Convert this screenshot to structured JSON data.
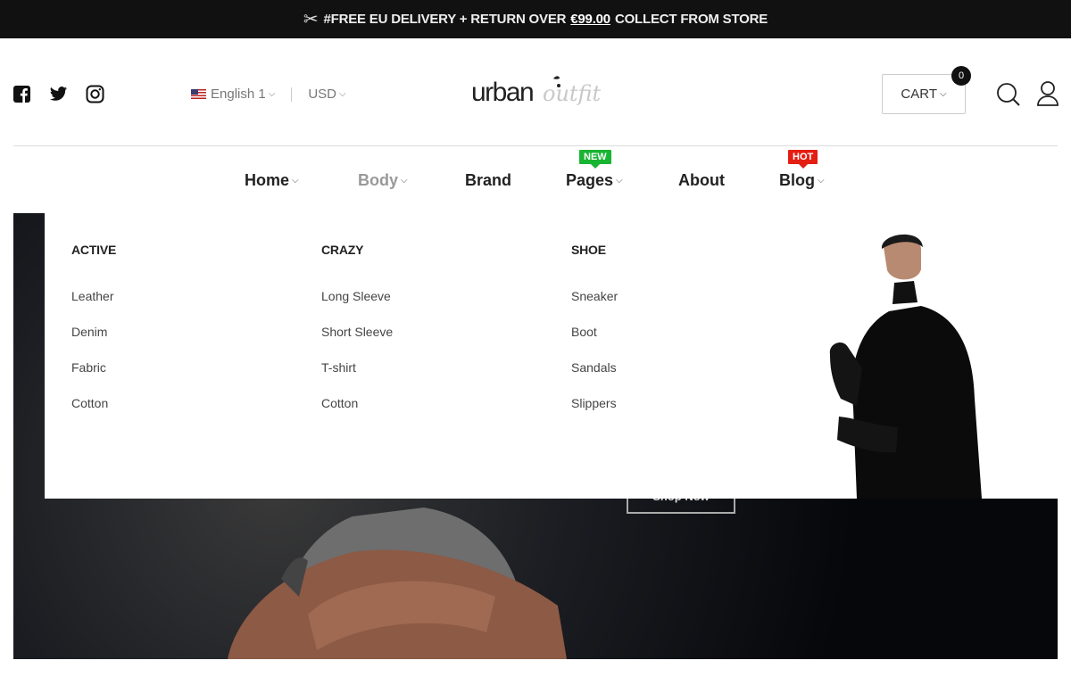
{
  "topbar": {
    "icon": "scissors-icon",
    "text_before": "#FREE EU DELIVERY + RETURN OVER",
    "price": "€99.00",
    "text_after": "COLLECT FROM STORE"
  },
  "social": [
    "facebook-icon",
    "twitter-icon",
    "instagram-icon"
  ],
  "language": {
    "selected": "English 1",
    "flag": "us-flag-icon"
  },
  "currency": {
    "selected": "USD"
  },
  "logo": {
    "text_main": "urban",
    "text_script": "outfit"
  },
  "cart": {
    "label": "CART",
    "count": "0"
  },
  "nav": {
    "items": [
      {
        "label": "Home",
        "has_dropdown": true
      },
      {
        "label": "Body",
        "has_dropdown": true,
        "active": true
      },
      {
        "label": "Brand",
        "has_dropdown": false
      },
      {
        "label": "Pages",
        "has_dropdown": true,
        "tag": "NEW"
      },
      {
        "label": "About",
        "has_dropdown": false
      },
      {
        "label": "Blog",
        "has_dropdown": true,
        "tag": "HOT"
      }
    ]
  },
  "mega_menu": {
    "columns": [
      {
        "title": "ACTIVE",
        "links": [
          "Leather",
          "Denim",
          "Fabric",
          "Cotton"
        ]
      },
      {
        "title": "CRAZY",
        "links": [
          "Long Sleeve",
          "Short Sleeve",
          "T-shirt",
          "Cotton"
        ]
      },
      {
        "title": "SHOE",
        "links": [
          "Sneaker",
          "Boot",
          "Sandals",
          "Slippers"
        ]
      }
    ]
  },
  "hero": {
    "button_label": "Shop Now"
  },
  "colors": {
    "topbar_bg": "#111111",
    "tag_new": "#18b432",
    "tag_hot": "#e41e12",
    "hero_bg": "#05070b"
  }
}
